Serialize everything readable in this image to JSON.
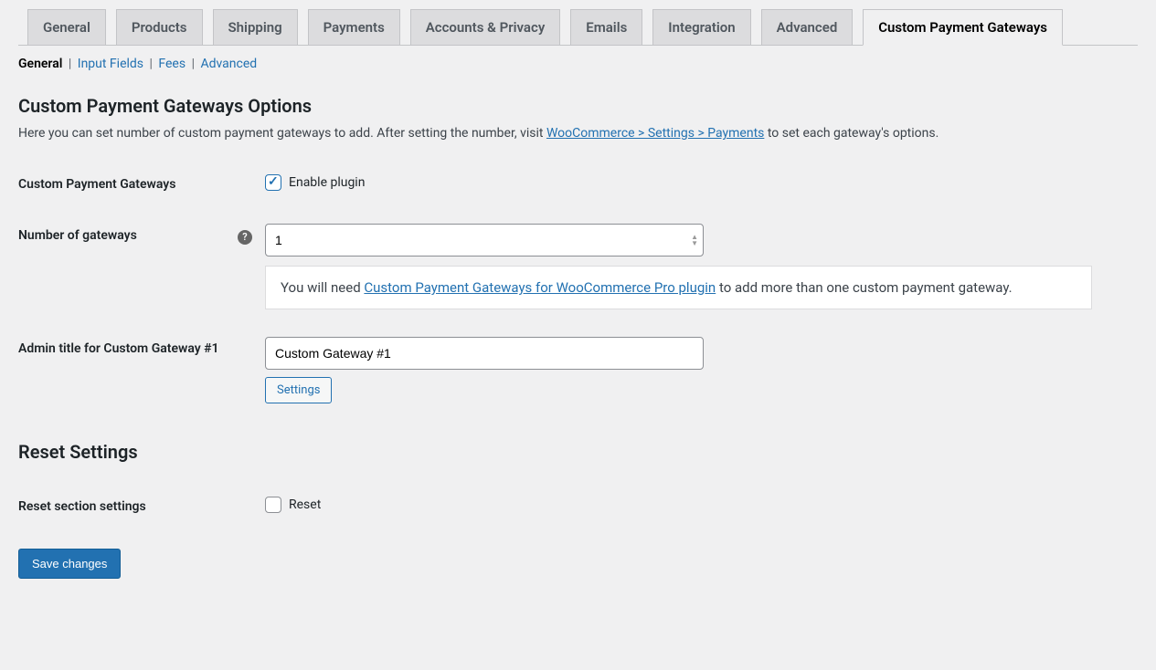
{
  "main_tabs": [
    {
      "label": "General"
    },
    {
      "label": "Products"
    },
    {
      "label": "Shipping"
    },
    {
      "label": "Payments"
    },
    {
      "label": "Accounts & Privacy"
    },
    {
      "label": "Emails"
    },
    {
      "label": "Integration"
    },
    {
      "label": "Advanced"
    },
    {
      "label": "Custom Payment Gateways",
      "active": true
    }
  ],
  "sub_tabs": [
    {
      "label": "General",
      "current": true
    },
    {
      "label": "Input Fields"
    },
    {
      "label": "Fees"
    },
    {
      "label": "Advanced"
    }
  ],
  "section": {
    "title": "Custom Payment Gateways Options",
    "desc_pre": "Here you can set number of custom payment gateways to add. After setting the number, visit ",
    "desc_link": "WooCommerce > Settings > Payments",
    "desc_post": " to set each gateway's options."
  },
  "fields": {
    "enable": {
      "label": "Custom Payment Gateways",
      "checkbox_label": "Enable plugin",
      "checked": true
    },
    "number": {
      "label": "Number of gateways",
      "value": "1",
      "help_icon": "?",
      "info_pre": "You will need ",
      "info_link": "Custom Payment Gateways for WooCommerce Pro plugin",
      "info_post": " to add more than one custom payment gateway."
    },
    "admin_title": {
      "label": "Admin title for Custom Gateway #1",
      "value": "Custom Gateway #1",
      "settings_button": "Settings"
    }
  },
  "reset": {
    "title": "Reset Settings",
    "label": "Reset section settings",
    "checkbox_label": "Reset"
  },
  "save_button": "Save changes"
}
